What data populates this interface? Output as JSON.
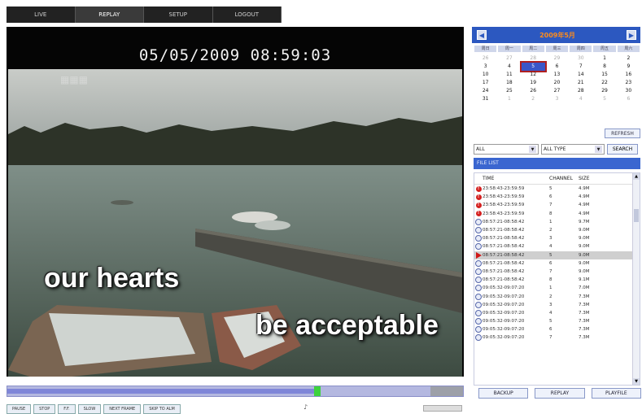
{
  "tabs": [
    {
      "label": "LIVE"
    },
    {
      "label": "REPLAY"
    },
    {
      "label": "SETUP"
    },
    {
      "label": "LOGOUT"
    }
  ],
  "video": {
    "osd_datetime": "05/05/2009 08:59:03",
    "caption_1": "our hearts",
    "caption_2": "be acceptable"
  },
  "calendar": {
    "month_label": "2009年5月",
    "weekdays": [
      "周日",
      "周一",
      "周二",
      "周三",
      "周四",
      "周五",
      "周六"
    ],
    "days": [
      {
        "d": "26",
        "other": true
      },
      {
        "d": "27",
        "other": true
      },
      {
        "d": "28",
        "other": true
      },
      {
        "d": "29",
        "other": true
      },
      {
        "d": "30",
        "other": true
      },
      {
        "d": "1"
      },
      {
        "d": "2"
      },
      {
        "d": "3"
      },
      {
        "d": "4"
      },
      {
        "d": "5",
        "sel": true
      },
      {
        "d": "6"
      },
      {
        "d": "7"
      },
      {
        "d": "8"
      },
      {
        "d": "9"
      },
      {
        "d": "10"
      },
      {
        "d": "11"
      },
      {
        "d": "12"
      },
      {
        "d": "13"
      },
      {
        "d": "14"
      },
      {
        "d": "15"
      },
      {
        "d": "16"
      },
      {
        "d": "17"
      },
      {
        "d": "18"
      },
      {
        "d": "19"
      },
      {
        "d": "20"
      },
      {
        "d": "21"
      },
      {
        "d": "22"
      },
      {
        "d": "23"
      },
      {
        "d": "24"
      },
      {
        "d": "25"
      },
      {
        "d": "26"
      },
      {
        "d": "27"
      },
      {
        "d": "28"
      },
      {
        "d": "29"
      },
      {
        "d": "30"
      },
      {
        "d": "31"
      },
      {
        "d": "1",
        "other": true
      },
      {
        "d": "2",
        "other": true
      },
      {
        "d": "3",
        "other": true
      },
      {
        "d": "4",
        "other": true
      },
      {
        "d": "5",
        "other": true
      },
      {
        "d": "6",
        "other": true
      }
    ],
    "refresh_label": "REFRESH"
  },
  "filters": {
    "channel_value": "ALL",
    "type_value": "ALL TYPE",
    "search_label": "SEARCH"
  },
  "filelist": {
    "title": "FILE LIST",
    "headers": {
      "time": "TIME",
      "channel": "CHANNEL",
      "size": "SIZE"
    },
    "rows": [
      {
        "icon": "alarm",
        "time": "23:58:43-23:59:59",
        "channel": "5",
        "size": "4.9M"
      },
      {
        "icon": "alarm",
        "time": "23:58:43-23:59:59",
        "channel": "6",
        "size": "4.9M"
      },
      {
        "icon": "alarm",
        "time": "23:58:43-23:59:59",
        "channel": "7",
        "size": "4.9M"
      },
      {
        "icon": "alarm",
        "time": "23:58:43-23:59:59",
        "channel": "8",
        "size": "4.9M"
      },
      {
        "icon": "normal",
        "time": "08:57:21-08:58:42",
        "channel": "1",
        "size": "9.7M"
      },
      {
        "icon": "normal",
        "time": "08:57:21-08:58:42",
        "channel": "2",
        "size": "9.0M"
      },
      {
        "icon": "normal",
        "time": "08:57:21-08:58:42",
        "channel": "3",
        "size": "9.0M"
      },
      {
        "icon": "normal",
        "time": "08:57:21-08:58:42",
        "channel": "4",
        "size": "9.0M"
      },
      {
        "icon": "playing",
        "time": "08:57:21-08:58:42",
        "channel": "5",
        "size": "9.0M",
        "sel": true
      },
      {
        "icon": "normal",
        "time": "08:57:21-08:58:42",
        "channel": "6",
        "size": "9.0M"
      },
      {
        "icon": "normal",
        "time": "08:57:21-08:58:42",
        "channel": "7",
        "size": "9.0M"
      },
      {
        "icon": "normal",
        "time": "08:57:21-08:58:42",
        "channel": "8",
        "size": "9.1M"
      },
      {
        "icon": "normal",
        "time": "09:05:32-09:07:20",
        "channel": "1",
        "size": "7.0M"
      },
      {
        "icon": "normal",
        "time": "09:05:32-09:07:20",
        "channel": "2",
        "size": "7.3M"
      },
      {
        "icon": "normal",
        "time": "09:05:32-09:07:20",
        "channel": "3",
        "size": "7.3M"
      },
      {
        "icon": "normal",
        "time": "09:05:32-09:07:20",
        "channel": "4",
        "size": "7.3M"
      },
      {
        "icon": "normal",
        "time": "09:05:32-09:07:20",
        "channel": "5",
        "size": "7.3M"
      },
      {
        "icon": "normal",
        "time": "09:05:32-09:07:20",
        "channel": "6",
        "size": "7.3M"
      },
      {
        "icon": "normal",
        "time": "09:05:32-09:07:20",
        "channel": "7",
        "size": "7.3M"
      }
    ]
  },
  "bottom_buttons": {
    "backup": "BACKUP",
    "replay": "REPLAY",
    "playfile": "PLAYFILE"
  },
  "controls": [
    {
      "label": "PAUSE"
    },
    {
      "label": "STOP"
    },
    {
      "label": "F.F."
    },
    {
      "label": "SLOW"
    },
    {
      "label": "NEXT FRAME"
    },
    {
      "label": "SKIP TO ALM"
    }
  ],
  "playback_progress": 0.73,
  "colors": {
    "accent": "#2c58c0",
    "alarm": "#d42020",
    "timeline_marker": "#3dd23d"
  }
}
